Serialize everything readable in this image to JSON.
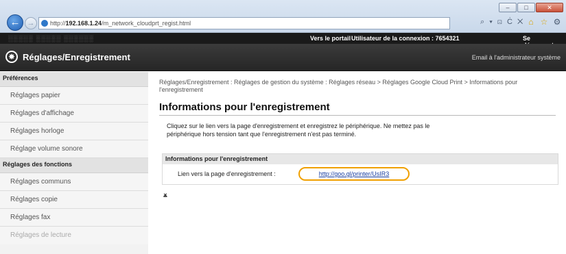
{
  "browser": {
    "url_prefix": "http://",
    "url_host": "192.168.1.24",
    "url_path": "/m_network_cloudprt_regist.html",
    "address_tools": "⌕ ▾ ⊡ Ċ ✕",
    "window_buttons": [
      "–",
      "□",
      "✕"
    ]
  },
  "topbar": {
    "portal_link": "Vers le portail",
    "user_label": "Utilisateur de la connexion : 7654321",
    "logout_link": "Se déconnecter"
  },
  "titlebar": {
    "title": "Réglages/Enregistrement",
    "email_admin": "Email à l'administrateur système"
  },
  "sidebar": {
    "section1": "Préférences",
    "section1_items": [
      "Réglages papier",
      "Réglages d'affichage",
      "Réglages horloge",
      "Réglage volume sonore"
    ],
    "section2": "Réglages des fonctions",
    "section2_items": [
      "Réglages communs",
      "Réglages copie",
      "Réglages fax",
      "Réglages de lecture"
    ]
  },
  "main": {
    "breadcrumb": "Réglages/Enregistrement : Réglages de gestion du système : Réglages réseau > Réglages Google Cloud Print > Informations pour l'enregistrement",
    "heading": "Informations pour l'enregistrement",
    "description": "Cliquez sur le lien vers la page d'enregistrement et enregistrez le périphérique. Ne mettez pas le périphérique hors tension tant que l'enregistrement n'est pas terminé.",
    "info_header": "Informations pour l'enregistrement",
    "info_label": "Lien vers la page d'enregistrement :",
    "info_link": "http://goo.gl/printer/UsIR3",
    "back_to_top": "⨱"
  }
}
